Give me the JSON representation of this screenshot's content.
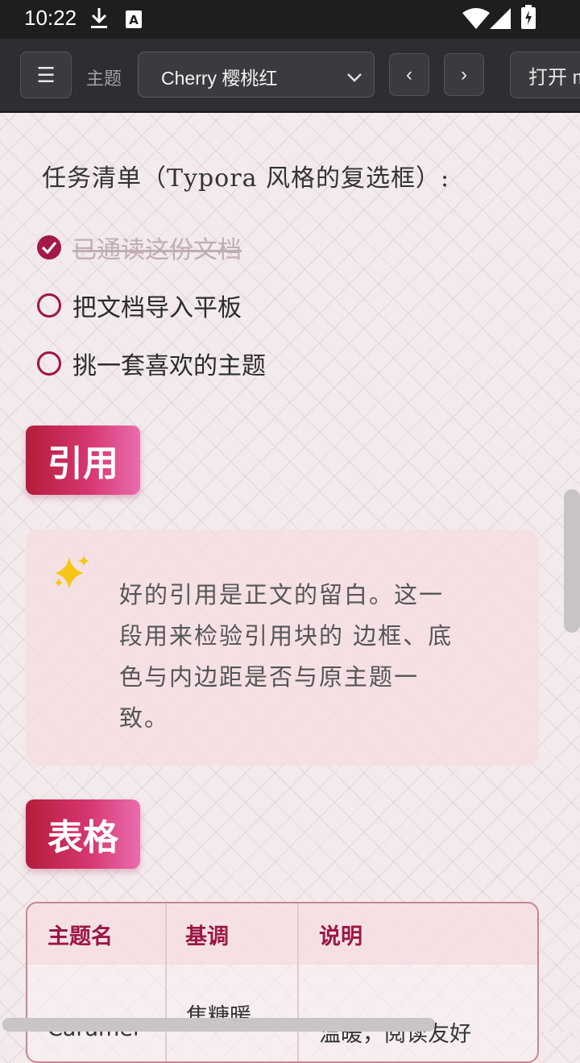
{
  "status_bar": {
    "time": "10:22",
    "icons": [
      "download-icon",
      "a-box-icon",
      "wifi-icon",
      "signal-icon",
      "battery-icon"
    ]
  },
  "toolbar": {
    "menu_glyph": "☰",
    "theme_label": "主题",
    "theme_selected": "Cherry 樱桃红",
    "prev_glyph": "‹",
    "next_glyph": "›",
    "open_label": "打开 m"
  },
  "tasks": {
    "title": "任务清单（Typora 风格的复选框）:",
    "items": [
      {
        "label": "已通读这份文档",
        "checked": true
      },
      {
        "label": "把文档导入平板",
        "checked": false
      },
      {
        "label": "挑一套喜欢的主题",
        "checked": false
      }
    ]
  },
  "quote_section": {
    "heading": "引用",
    "icon": "sparkles-icon",
    "lines": [
      "好的引用是正文的留白。这一",
      "段用来检验引用块的 边框、底",
      "色与内边距是否与原主题一",
      "致。"
    ]
  },
  "table_section": {
    "heading": "表格",
    "headers": [
      "主题名",
      "基调",
      "说明"
    ],
    "row1": [
      "Caramel",
      "焦糖暖",
      "温暖，阅读友好"
    ]
  },
  "colors": {
    "accent": "#a31845",
    "toolbar_bg": "#2c2e31",
    "page_bg": "#f3eaeb"
  }
}
